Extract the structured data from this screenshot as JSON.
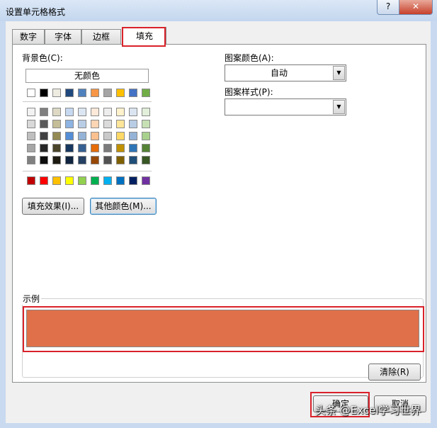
{
  "window": {
    "title": "设置单元格格式",
    "help_label": "?",
    "close_label": "✕"
  },
  "tabs": [
    {
      "label": "数字"
    },
    {
      "label": "字体"
    },
    {
      "label": "边框"
    },
    {
      "label": "填充",
      "active": true
    }
  ],
  "background_color": {
    "label": "背景色(C):",
    "no_color_label": "无颜色",
    "top_row": [
      "#ffffff",
      "#000000",
      "#eeece1",
      "#1f497d",
      "#4f81bd",
      "#f79646",
      "#a5a5a5",
      "#ffc000",
      "#4472c4",
      "#70ad47"
    ],
    "theme_rows": [
      [
        "#f2f2f2",
        "#7f7f7f",
        "#ddd9c4",
        "#c6d9f1",
        "#dce6f2",
        "#fde9d9",
        "#ededed",
        "#fff2cc",
        "#dbe5f1",
        "#e2efda"
      ],
      [
        "#d9d9d9",
        "#595959",
        "#c4bd97",
        "#8eb4e3",
        "#b9cde5",
        "#fcd5b5",
        "#dbdbdb",
        "#ffe699",
        "#b8cce4",
        "#c6e0b4"
      ],
      [
        "#bfbfbf",
        "#404040",
        "#948a54",
        "#558ed5",
        "#95b3d7",
        "#fac090",
        "#c9c9c9",
        "#ffd966",
        "#95b3d7",
        "#a9d18e"
      ],
      [
        "#a6a6a6",
        "#262626",
        "#4a452a",
        "#17375e",
        "#366092",
        "#e46c0a",
        "#7b7b7b",
        "#bf9000",
        "#2e75b6",
        "#548235"
      ],
      [
        "#808080",
        "#0d0d0d",
        "#1d1b11",
        "#10243f",
        "#244062",
        "#974806",
        "#525252",
        "#7f6000",
        "#1f4e79",
        "#375623"
      ]
    ],
    "standard_row": [
      "#c00000",
      "#ff0000",
      "#ffc000",
      "#ffff00",
      "#92d050",
      "#00b050",
      "#00b0f0",
      "#0070c0",
      "#002060",
      "#7030a0"
    ]
  },
  "buttons": {
    "fill_effects": "填充效果(I)...",
    "more_colors": "其他颜色(M)...",
    "clear": "清除(R)",
    "ok": "确定",
    "cancel": "取消"
  },
  "pattern_color": {
    "label": "图案颜色(A):",
    "value": "自动"
  },
  "pattern_style": {
    "label": "图案样式(P):",
    "value": ""
  },
  "sample": {
    "label": "示例",
    "color": "#e07049"
  },
  "watermark": "头条 @Excel学习世界",
  "colors": {
    "highlight": "#d9222a"
  }
}
